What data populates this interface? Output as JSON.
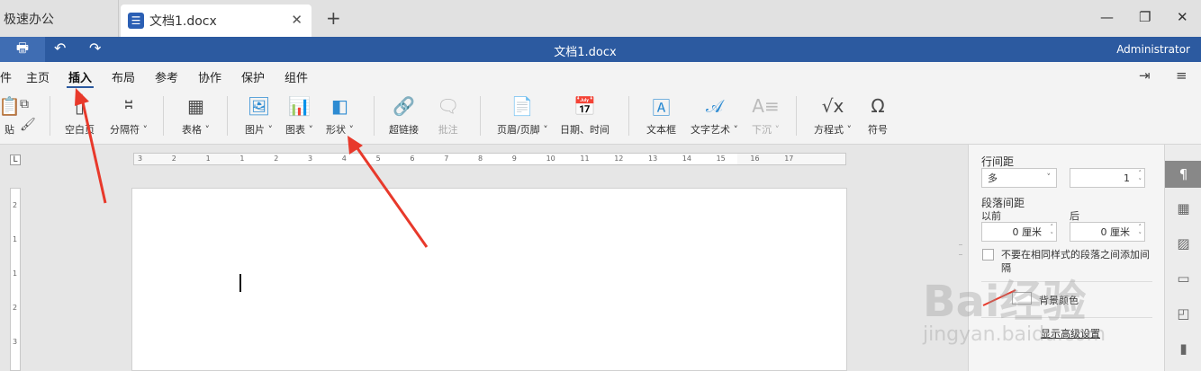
{
  "tabs": {
    "app_tab": "极速办公",
    "doc_tab": "文档1.docx",
    "close": "✕",
    "new": "+"
  },
  "window": {
    "minimize": "—",
    "restore": "❐",
    "close": "✕"
  },
  "titlebar": {
    "title": "文档1.docx",
    "user": "Administrator"
  },
  "menu": [
    "件",
    "主页",
    "插入",
    "布局",
    "参考",
    "协作",
    "保护",
    "组件"
  ],
  "ribbon": {
    "paste": "贴",
    "blank_page": "空白页",
    "page_break": "分隔符",
    "table": "表格",
    "picture": "图片",
    "chart": "图表",
    "shape": "形状",
    "hyperlink": "超链接",
    "comment": "批注",
    "header_footer": "页眉/页脚",
    "datetime": "日期、时间",
    "textbox": "文本框",
    "textart": "文字艺术",
    "dropcap": "下沉",
    "equation": "方程式",
    "symbol": "符号"
  },
  "ruler": {
    "corner": "L",
    "ticks": [
      "3",
      "2",
      "1",
      "1",
      "2",
      "3",
      "4",
      "5",
      "6",
      "7",
      "8",
      "9",
      "10",
      "11",
      "12",
      "13",
      "14",
      "15",
      "16",
      "17"
    ],
    "vticks": [
      "2",
      "1",
      "1",
      "2",
      "3"
    ]
  },
  "side_panel": {
    "line_spacing_label": "行间距",
    "line_spacing_mode": "多",
    "line_spacing_value": "1",
    "para_spacing_label": "段落间距",
    "before_label": "以前",
    "after_label": "后",
    "before_value": "0 厘米",
    "after_value": "0 厘米",
    "no_space_checkbox": "不要在相同样式的段落之间添加间隔",
    "bg_color": "背景颜色",
    "advanced": "显示高级设置"
  },
  "watermark": {
    "line1": "Bai经验",
    "line2": "jingyan.baidu.com"
  }
}
